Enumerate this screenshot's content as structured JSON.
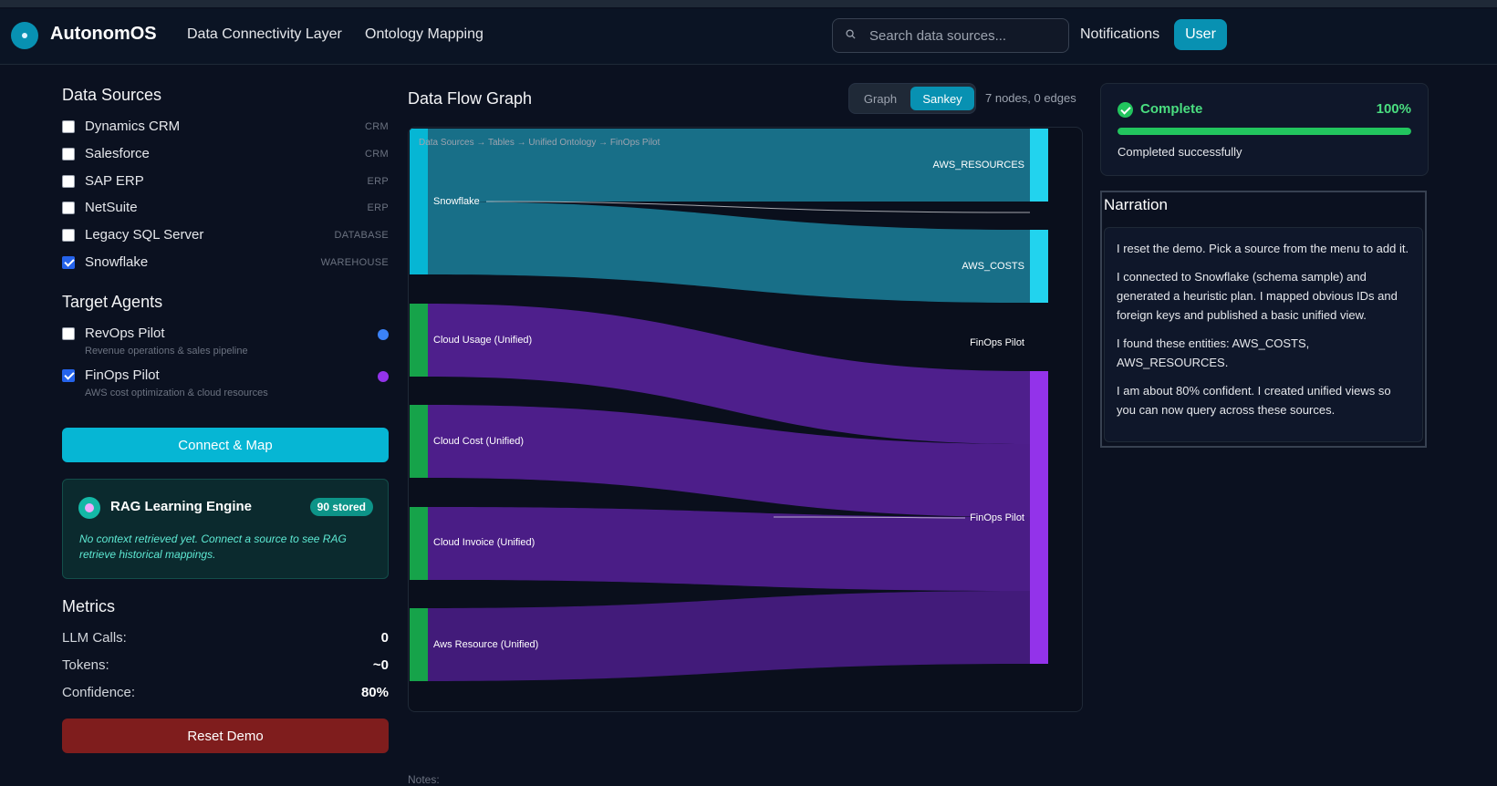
{
  "app": {
    "title": "AutonomOS"
  },
  "nav": {
    "items": [
      "Data Connectivity Layer",
      "Ontology Mapping"
    ]
  },
  "search": {
    "placeholder": "Search data sources..."
  },
  "header": {
    "notifications": "Notifications",
    "user": "User"
  },
  "sidebar": {
    "sources_title": "Data Sources",
    "sources": [
      {
        "name": "Dynamics CRM",
        "type": "CRM",
        "checked": false
      },
      {
        "name": "Salesforce",
        "type": "CRM",
        "checked": false
      },
      {
        "name": "SAP ERP",
        "type": "ERP",
        "checked": false
      },
      {
        "name": "NetSuite",
        "type": "ERP",
        "checked": false
      },
      {
        "name": "Legacy SQL Server",
        "type": "DATABASE",
        "checked": false
      },
      {
        "name": "Snowflake",
        "type": "WAREHOUSE",
        "checked": true
      }
    ],
    "agents_title": "Target Agents",
    "agents": [
      {
        "name": "RevOps Pilot",
        "desc": "Revenue operations & sales pipeline",
        "checked": false,
        "color": "#3b82f6"
      },
      {
        "name": "FinOps Pilot",
        "desc": "AWS cost optimization & cloud resources",
        "checked": true,
        "color": "#9333ea"
      }
    ],
    "connect_label": "Connect & Map",
    "rag": {
      "title": "RAG Learning Engine",
      "badge": "90 stored",
      "text": "No context retrieved yet. Connect a source to see RAG retrieve historical mappings."
    },
    "metrics_title": "Metrics",
    "metrics": [
      {
        "label": "LLM Calls:",
        "value": "0"
      },
      {
        "label": "Tokens:",
        "value": "~0"
      },
      {
        "label": "Confidence:",
        "value": "80%"
      }
    ],
    "reset_label": "Reset Demo"
  },
  "graph": {
    "title": "Data Flow Graph",
    "toggle": [
      "Graph",
      "Sankey"
    ],
    "active_toggle": "Sankey",
    "counts": "7 nodes, 0 edges",
    "notes_label": "Notes:"
  },
  "sankey": {
    "breadcrumb": "Data Sources → Tables → Unified Ontology → FinOps Pilot",
    "source_node": "Snowflake",
    "tables": [
      "AWS_RESOURCES",
      "AWS_COSTS"
    ],
    "unified": [
      "Cloud Usage (Unified)",
      "Cloud Cost (Unified)",
      "Cloud Invoice (Unified)",
      "Aws Resource (Unified)"
    ],
    "agent_labels": [
      "FinOps Pilot",
      "FinOps Pilot"
    ],
    "colors": {
      "source": "#06b6d4",
      "table_node": "#22d3ee",
      "table_link": "#186f88",
      "unified_node": "#16a34a",
      "agent_node": "#9333ea",
      "unified_link": "#4c1d95"
    }
  },
  "status": {
    "label": "Complete",
    "percent_text": "100%",
    "progress": 1.0,
    "message": "Completed successfully"
  },
  "narration": {
    "title": "Narration",
    "paragraphs": [
      "I reset the demo. Pick a source from the menu to add it.",
      "I connected to Snowflake (schema sample) and generated a heuristic plan. I mapped obvious IDs and foreign keys and published a basic unified view.",
      "I found these entities: AWS_COSTS, AWS_RESOURCES.",
      "I am about 80% confident. I created unified views so you can now query across these sources."
    ]
  }
}
